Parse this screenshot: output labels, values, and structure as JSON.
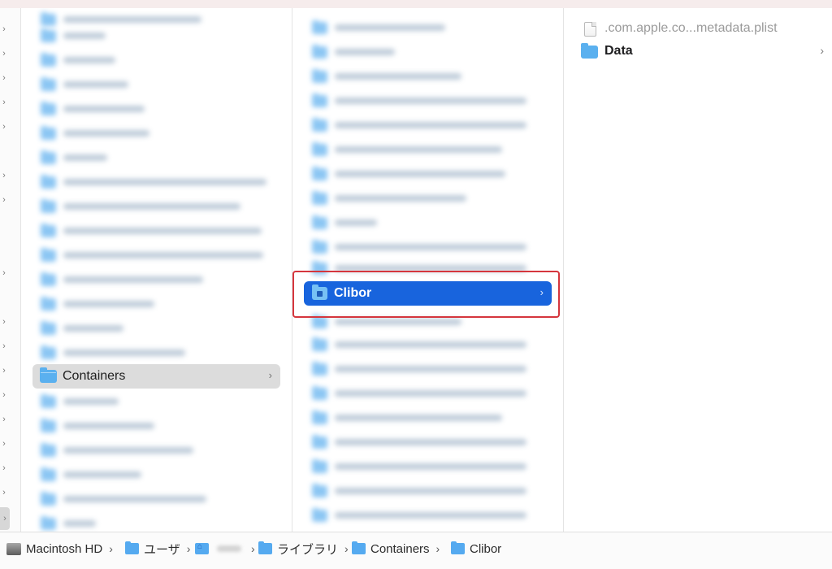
{
  "columns": {
    "col1": {
      "active_item": {
        "label": "Containers"
      }
    },
    "col2": {
      "selected_item": {
        "label": "Clibor"
      }
    },
    "col3": {
      "items": [
        {
          "label": ".com.apple.co...metadata.plist",
          "kind": "file"
        },
        {
          "label": "Data",
          "kind": "folder"
        }
      ]
    }
  },
  "pathbar": {
    "items": [
      {
        "label": "Macintosh HD",
        "icon": "hard-drive-icon"
      },
      {
        "label": "ユーザ",
        "icon": "users-folder-icon"
      },
      {
        "label": "",
        "icon": "home-folder-icon"
      },
      {
        "label": "ライブラリ",
        "icon": "library-folder-icon"
      },
      {
        "label": "Containers",
        "icon": "folder-icon"
      },
      {
        "label": "Clibor",
        "icon": "app-folder-icon"
      }
    ]
  },
  "colors": {
    "selection": "#1864dd",
    "active_row": "#dcdcdc",
    "folder": "#5ab0ef",
    "highlight": "#d5363d"
  }
}
